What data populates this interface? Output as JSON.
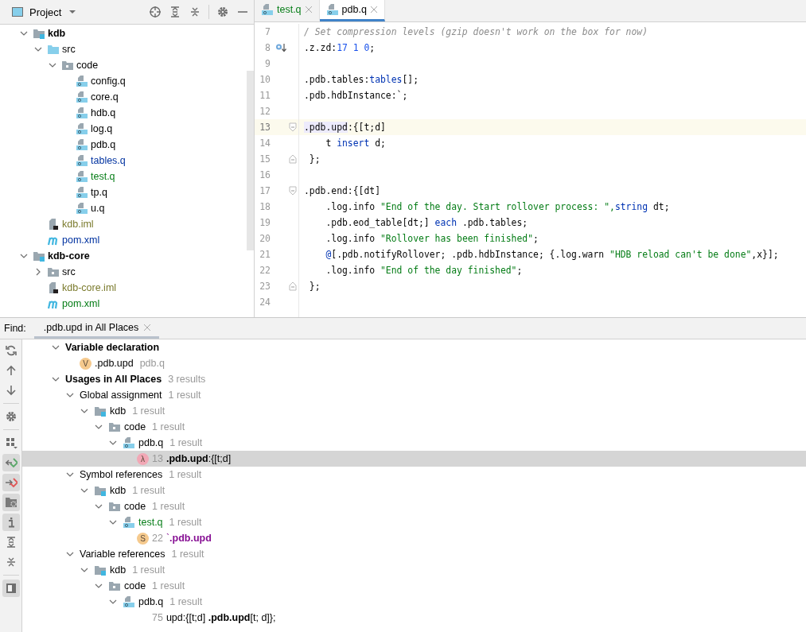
{
  "project": {
    "title": "Project",
    "tree": [
      {
        "kind": "module",
        "name": "kdb",
        "expanded": true,
        "children": [
          {
            "kind": "source-folder",
            "name": "src",
            "expanded": true,
            "children": [
              {
                "kind": "folder",
                "name": "code",
                "expanded": true,
                "children": [
                  {
                    "kind": "qfile",
                    "name": "config.q"
                  },
                  {
                    "kind": "qfile",
                    "name": "core.q"
                  },
                  {
                    "kind": "qfile",
                    "name": "hdb.q"
                  },
                  {
                    "kind": "qfile",
                    "name": "log.q"
                  },
                  {
                    "kind": "qfile",
                    "name": "pdb.q"
                  },
                  {
                    "kind": "qfile",
                    "name": "tables.q",
                    "color": "#0032a0"
                  },
                  {
                    "kind": "qfile",
                    "name": "test.q",
                    "color": "#067d17"
                  },
                  {
                    "kind": "qfile",
                    "name": "tp.q"
                  },
                  {
                    "kind": "qfile",
                    "name": "u.q"
                  }
                ]
              }
            ]
          },
          {
            "kind": "iml",
            "name": "kdb.iml",
            "color": "#7a7a2c"
          },
          {
            "kind": "pom",
            "name": "pom.xml",
            "color": "#0032a0"
          }
        ]
      },
      {
        "kind": "module",
        "name": "kdb-core",
        "expanded": true,
        "children": [
          {
            "kind": "folder",
            "name": "src",
            "expanded": false
          },
          {
            "kind": "iml",
            "name": "kdb-core.iml",
            "color": "#7a7a2c"
          },
          {
            "kind": "pom",
            "name": "pom.xml",
            "color": "#067d17"
          }
        ]
      }
    ]
  },
  "editor": {
    "tabs": [
      {
        "label": "test.q",
        "selected": false,
        "color": "#067d17"
      },
      {
        "label": "pdb.q",
        "selected": true,
        "color": "#000000"
      }
    ],
    "lines": [
      {
        "num": "7",
        "current": false,
        "tokens": [
          {
            "kind": "comment",
            "text": "/ Set compression levels (gzip doesn't work on the box for now)"
          }
        ]
      },
      {
        "num": "8",
        "current": false,
        "overridden": true,
        "tokens": [
          {
            "kind": "plain",
            "text": ".z.zd:"
          },
          {
            "kind": "number",
            "text": "17 1 0"
          },
          {
            "kind": "plain",
            "text": ";"
          }
        ]
      },
      {
        "num": "9",
        "current": false
      },
      {
        "num": "10",
        "current": false,
        "tokens": [
          {
            "kind": "plain",
            "text": ".pdb.tables:"
          },
          {
            "kind": "keyword",
            "text": "tables"
          },
          {
            "kind": "plain",
            "text": "[];"
          }
        ]
      },
      {
        "num": "11",
        "current": false,
        "tokens": [
          {
            "kind": "plain",
            "text": ".pdb.hdbInstance:`;"
          }
        ]
      },
      {
        "num": "12",
        "current": false
      },
      {
        "num": "13",
        "current": true,
        "fold_start": true,
        "tokens": [
          {
            "kind": "match",
            "text": ".pdb.upd"
          },
          {
            "kind": "plain",
            "text": ":{[t;d]"
          }
        ]
      },
      {
        "num": "14",
        "current": false,
        "tokens": [
          {
            "kind": "plain",
            "text": "    t "
          },
          {
            "kind": "keyword",
            "text": "insert"
          },
          {
            "kind": "plain",
            "text": " d;"
          }
        ]
      },
      {
        "num": "15",
        "current": false,
        "fold_end": true,
        "tokens": [
          {
            "kind": "plain",
            "text": " };"
          }
        ]
      },
      {
        "num": "16",
        "current": false
      },
      {
        "num": "17",
        "current": false,
        "fold_start": true,
        "tokens": [
          {
            "kind": "plain",
            "text": ".pdb.end:{[dt]"
          }
        ]
      },
      {
        "num": "18",
        "current": false,
        "tokens": [
          {
            "kind": "plain",
            "text": "    .log.info "
          },
          {
            "kind": "string",
            "text": "\"End of the day. Start rollover process: \","
          },
          {
            "kind": "keyword",
            "text": "string"
          },
          {
            "kind": "plain",
            "text": " dt;"
          }
        ]
      },
      {
        "num": "19",
        "current": false,
        "tokens": [
          {
            "kind": "plain",
            "text": "    .pdb.eod_table[dt;] "
          },
          {
            "kind": "keyword",
            "text": "each"
          },
          {
            "kind": "plain",
            "text": " .pdb.tables;"
          }
        ]
      },
      {
        "num": "20",
        "current": false,
        "tokens": [
          {
            "kind": "plain",
            "text": "    .log.info "
          },
          {
            "kind": "string",
            "text": "\"Rollover has been finished\""
          },
          {
            "kind": "plain",
            "text": ";"
          }
        ]
      },
      {
        "num": "21",
        "current": false,
        "tokens": [
          {
            "kind": "keyword",
            "text": "    @"
          },
          {
            "kind": "plain",
            "text": "[.pdb.notifyRollover; .pdb.hdbInstance; {.log.warn "
          },
          {
            "kind": "string",
            "text": "\"HDB reload can't be done\""
          },
          {
            "kind": "plain",
            "text": ",x}];"
          }
        ]
      },
      {
        "num": "22",
        "current": false,
        "tokens": [
          {
            "kind": "plain",
            "text": "    .log.info "
          },
          {
            "kind": "string",
            "text": "\"End of the day finished\""
          },
          {
            "kind": "plain",
            "text": ";"
          }
        ]
      },
      {
        "num": "23",
        "current": false,
        "fold_end": true,
        "tokens": [
          {
            "kind": "plain",
            "text": " };"
          }
        ]
      },
      {
        "num": "24",
        "current": false
      }
    ]
  },
  "find": {
    "label": "Find:",
    "tab": ".pdb.upd in All Places",
    "toolbar": [
      {
        "kind": "rerun",
        "on": false
      },
      {
        "kind": "up",
        "on": false
      },
      {
        "kind": "down",
        "on": false
      },
      {
        "kind": "separator"
      },
      {
        "kind": "settings",
        "on": false
      },
      {
        "kind": "separator"
      },
      {
        "kind": "group",
        "on": false
      },
      {
        "kind": "read-access",
        "on": true
      },
      {
        "kind": "write-access",
        "on": true
      },
      {
        "kind": "folder-filter",
        "on": true
      },
      {
        "kind": "info",
        "on": true
      },
      {
        "kind": "expand-all",
        "on": false
      },
      {
        "kind": "collapse-all",
        "on": false
      },
      {
        "kind": "separator"
      },
      {
        "kind": "preview",
        "on": true
      }
    ],
    "tree": [
      {
        "kind": "group",
        "label": "Variable declaration",
        "expanded": true,
        "selected": false,
        "children": [
          {
            "kind": "declaration",
            "badge": "V",
            "color": "#f5c98d",
            "label": ".pdb.upd",
            "location": "pdb.q",
            "selected": false
          }
        ]
      },
      {
        "kind": "group",
        "label": "Usages in All Places",
        "count": "3 results",
        "expanded": true,
        "selected": false,
        "children": [
          {
            "kind": "category",
            "label": "Global assignment",
            "count": "1 result",
            "expanded": true,
            "selected": false,
            "children": [
              {
                "kind": "module",
                "label": "kdb",
                "count": "1 result",
                "expanded": true,
                "selected": false,
                "children": [
                  {
                    "kind": "folder",
                    "label": "code",
                    "count": "1 result",
                    "expanded": true,
                    "selected": false,
                    "children": [
                      {
                        "kind": "qfile",
                        "label": "pdb.q",
                        "count": "1 result",
                        "expanded": true,
                        "selected": false,
                        "children": [
                          {
                            "kind": "usage",
                            "badge": "λ",
                            "color": "#f2a7b5",
                            "line": "13",
                            "text": "**.pdb.upd**:{[t;d]",
                            "selected": true
                          }
                        ]
                      }
                    ]
                  }
                ]
              }
            ]
          },
          {
            "kind": "category",
            "label": "Symbol references",
            "count": "1 result",
            "expanded": true,
            "selected": false,
            "children": [
              {
                "kind": "module",
                "label": "kdb",
                "count": "1 result",
                "expanded": true,
                "selected": false,
                "children": [
                  {
                    "kind": "folder",
                    "label": "code",
                    "count": "1 result",
                    "expanded": true,
                    "selected": false,
                    "children": [
                      {
                        "kind": "qfile",
                        "label": "test.q",
                        "color": "#067d17",
                        "count": "1 result",
                        "expanded": true,
                        "selected": false,
                        "children": [
                          {
                            "kind": "symbol-usage",
                            "badge": "S",
                            "color": "#f5c98d",
                            "line": "22",
                            "text": "`**.pdb.upd**",
                            "selected": false
                          }
                        ]
                      }
                    ]
                  }
                ]
              }
            ]
          },
          {
            "kind": "category",
            "label": "Variable references",
            "count": "1 result",
            "expanded": true,
            "selected": false,
            "children": [
              {
                "kind": "module",
                "label": "kdb",
                "count": "1 result",
                "expanded": true,
                "selected": false,
                "children": [
                  {
                    "kind": "folder",
                    "label": "code",
                    "count": "1 result",
                    "expanded": true,
                    "selected": false,
                    "children": [
                      {
                        "kind": "qfile",
                        "label": "pdb.q",
                        "count": "1 result",
                        "expanded": true,
                        "selected": false,
                        "children": [
                          {
                            "kind": "usage",
                            "line": "75",
                            "text": "upd:{[t;d] **.pdb.upd**[t; d]};",
                            "selected": false
                          }
                        ]
                      }
                    ]
                  }
                ]
              }
            ]
          }
        ]
      }
    ]
  }
}
